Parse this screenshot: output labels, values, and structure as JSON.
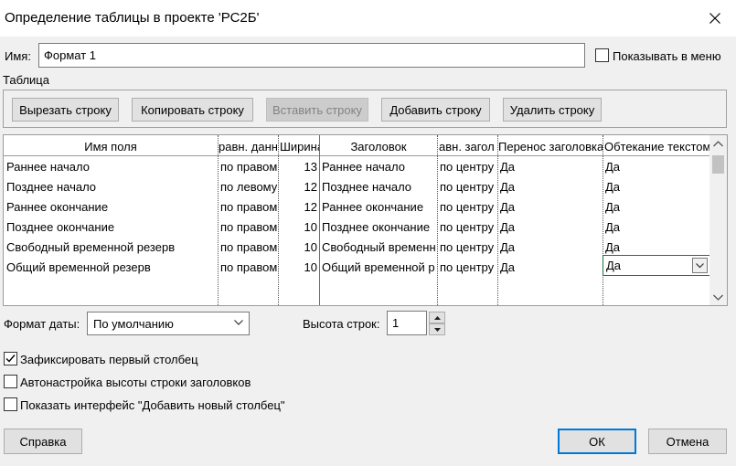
{
  "window": {
    "title": "Определение таблицы в проекте 'РС2Б'"
  },
  "name_field": {
    "label": "Имя:",
    "value": "Формат 1"
  },
  "show_in_menu": {
    "label": "Показывать в меню",
    "checked": false
  },
  "table_section": {
    "label": "Таблица"
  },
  "toolbar": {
    "cut_row": "Вырезать строку",
    "copy_row": "Копировать строку",
    "paste_row": "Вставить строку",
    "add_row": "Добавить строку",
    "delete_row": "Удалить строку"
  },
  "grid": {
    "headers": [
      "Имя поля",
      "равн. данн",
      "Ширина",
      "Заголовок",
      "авн. загол",
      "Перенос заголовка",
      "Обтекание текстом"
    ],
    "rows": [
      [
        "Раннее начало",
        "по правом",
        "13",
        "Раннее начало",
        "по центру",
        "Да",
        "Да"
      ],
      [
        "Позднее начало",
        "по левому",
        "12",
        "Позднее начало",
        "по центру",
        "Да",
        "Да"
      ],
      [
        "Раннее окончание",
        "по правом",
        "12",
        "Раннее окончание",
        "по центру",
        "Да",
        "Да"
      ],
      [
        "Позднее окончание",
        "по правом",
        "10",
        "Позднее окончание",
        "по центру",
        "Да",
        "Да"
      ],
      [
        "Свободный временной резерв",
        "по правом",
        "10",
        "Свободный временн",
        "по центру",
        "Да",
        "Да"
      ],
      [
        "Общий временной резерв",
        "по правом",
        "10",
        "Общий временной р",
        "по центру",
        "Да",
        "Да"
      ]
    ]
  },
  "date_format": {
    "label": "Формат даты:",
    "value": "По умолчанию"
  },
  "row_height": {
    "label": "Высота строк:",
    "value": "1"
  },
  "options": {
    "freeze_first_column": {
      "label": "Зафиксировать первый столбец",
      "checked": true
    },
    "auto_header_height": {
      "label": "Автонастройка высоты строки заголовков",
      "checked": false
    },
    "show_add_column": {
      "label": "Показать интерфейс \"Добавить новый столбец\"",
      "checked": false
    }
  },
  "footer": {
    "help": "Справка",
    "ok": "ОК",
    "cancel": "Отмена"
  },
  "colors": {
    "accent": "#0078d7",
    "active_cell_border": "#217346"
  }
}
